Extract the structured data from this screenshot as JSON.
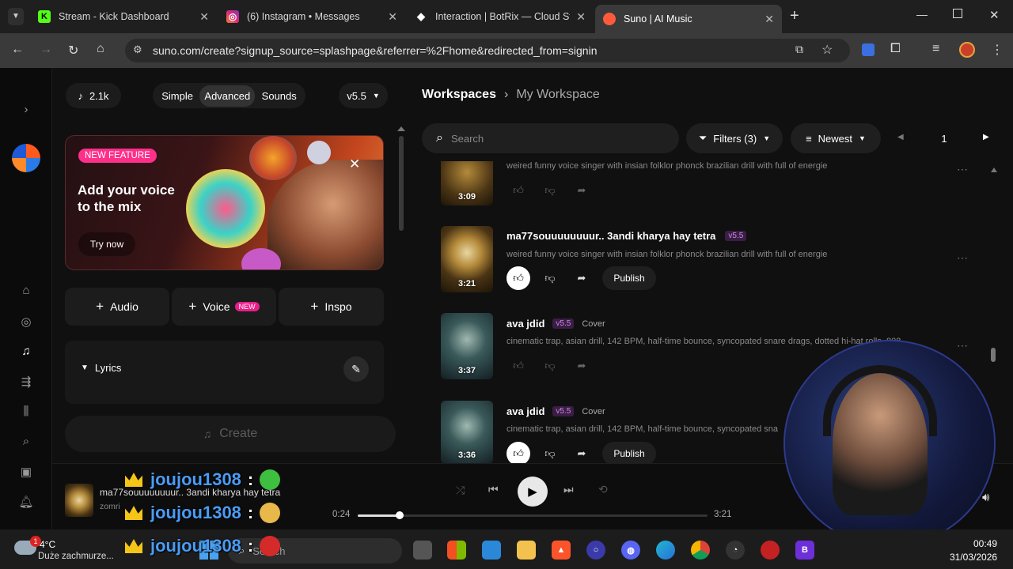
{
  "browser": {
    "tabs": [
      {
        "title": "Stream - Kick Dashboard",
        "favicon_color": "#53fc18",
        "favicon": "K"
      },
      {
        "title": "(6) Instagram • Messages",
        "favicon_color": "#dd2a7b",
        "favicon": "◎"
      },
      {
        "title": "Interaction | BotRix — Cloud St",
        "favicon_color": "#ffffff",
        "favicon": "◆"
      },
      {
        "title": "Suno | AI Music",
        "favicon_color": "#ff5a3c",
        "favicon": "●"
      }
    ],
    "new_tab": "+",
    "url": "suno.com/create?signup_source=splashpage&referrer=%2Fhome&redirected_from=signin"
  },
  "left": {
    "credits": "2.1k",
    "modes": [
      "Simple",
      "Advanced",
      "Sounds"
    ],
    "active_mode": "Advanced",
    "version": "v5.5",
    "promo": {
      "badge": "NEW FEATURE",
      "title": "Add your voice to the mix",
      "cta": "Try now"
    },
    "add_buttons": {
      "audio": "Audio",
      "voice": "Voice",
      "voice_badge": "NEW",
      "inspo": "Inspo"
    },
    "lyrics_label": "Lyrics",
    "create_label": "Create"
  },
  "right": {
    "breadcrumb_root": "Workspaces",
    "breadcrumb_current": "My Workspace",
    "search_placeholder": "Search",
    "filters": "Filters (3)",
    "sort": "Newest",
    "page": "1",
    "songs": [
      {
        "title": "",
        "desc": "weired funny voice singer with insian folklor phonck brazilian drill with full of energie",
        "duration": "3:09",
        "version": "",
        "cover_tag": "",
        "published": false
      },
      {
        "title": "ma77souuuuuuuur.. 3andi kharya hay tetra",
        "desc": "weired funny voice singer with insian folklor phonck brazilian drill with full of energie",
        "duration": "3:21",
        "version": "v5.5",
        "cover_tag": "",
        "published": true,
        "publish_label": "Publish"
      },
      {
        "title": "ava jdid",
        "desc": "cinematic trap, asian drill, 142 BPM, half-time bounce, syncopated snare drags, dotted hi-hat rolls, 808",
        "duration": "3:37",
        "version": "v5.5",
        "cover_tag": "Cover",
        "published": false
      },
      {
        "title": "ava jdid",
        "desc": "cinematic trap, asian drill, 142 BPM, half-time bounce, syncopated sna",
        "duration": "3:36",
        "version": "v5.5",
        "cover_tag": "Cover",
        "published": true,
        "publish_label": "Publish"
      }
    ]
  },
  "player": {
    "title": "ma77souuuuuuuur.. 3andi kharya hay tetra",
    "artist": "zomri",
    "elapsed": "0:24",
    "total": "3:21",
    "progress": 0.12
  },
  "chat": [
    {
      "user": "joujou1308",
      "emote_color": "#3fbf3f"
    },
    {
      "user": "joujou1308",
      "emote_color": "#e8b84a"
    },
    {
      "user": "joujou1308",
      "emote_color": "#d42a2a"
    }
  ],
  "taskbar": {
    "weather_temp": "4°C",
    "weather_desc": "Duże zachmurze...",
    "weather_badge": "1",
    "search_placeholder": "Search",
    "time": "00:49",
    "date": "31/03/2026"
  }
}
